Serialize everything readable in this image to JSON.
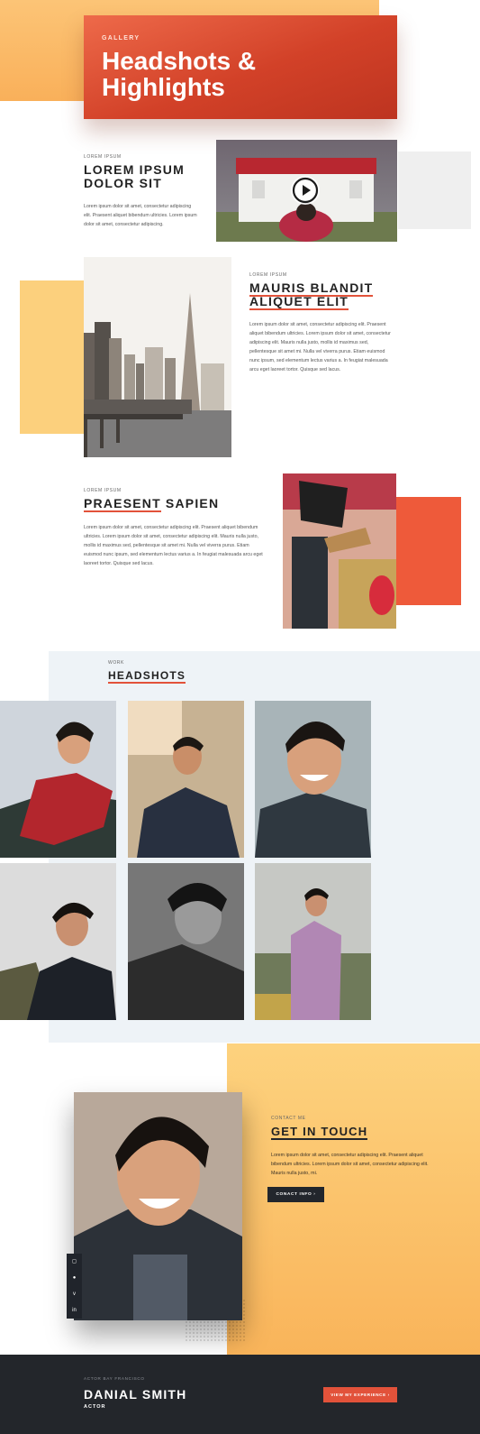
{
  "hero": {
    "kicker": "GALLERY",
    "title": "Headshots & Highlights"
  },
  "section1": {
    "kicker": "LOREM IPSUM",
    "title": "LOREM IPSUM DOLOR SIT",
    "text": "Lorem ipsum dolor sit amet, consectetur adipiscing elit. Praesent aliquet bibendum ultricies. Lorem ipsum dolor sit amet, consectetur adipiscing."
  },
  "section2": {
    "kicker": "LOREM IPSUM",
    "title": "MAURIS BLANDIT ALIQUET ELIT",
    "text": "Lorem ipsum dolor sit amet, consectetur adipiscing elit. Praesent aliquet bibendum ultricies. Lorem ipsum dolor sit amet, consectetur adipiscing elit. Mauris nulla justo, mollis id maximus sed, pellentesque sit amet mi. Nulla vel viverra purus. Etiam euismod nunc ipsum, sed elementum lectus varius a. In feugiat malesuada arcu eget laoreet tortor. Quisque sed lacus."
  },
  "section3": {
    "kicker": "LOREM IPSUM",
    "title_accent": "PRAESENT",
    "title_rest": " SAPIEN",
    "text": "Lorem ipsum dolor sit amet, consectetur adipiscing elit. Praesent aliquet bibendum ultricies. Lorem ipsum dolor sit amet, consectetur adipiscing elit. Mauris nulla justo, mollis id maximus sed, pellentesque sit amet mi. Nulla vel viverra purus. Etiam euismod nunc ipsum, sed elementum lectus varius a. In feugiat malesuada arcu eget laoreet tortor. Quisque sed lacus."
  },
  "headshots": {
    "kicker": "WORK",
    "title": "HEADSHOTS"
  },
  "contact": {
    "kicker": "CONTACT ME",
    "title": "GET IN TOUCH",
    "text": "Lorem ipsum dolor sit amet, consectetur adipiscing elit. Praesent aliquet bibendum ultricies. Lorem ipsum dolor sit amet, consectetur adipiscing elit. Mauris nulla justo, mi.",
    "button": "CONACT INFO  ›",
    "social": [
      "instagram-icon",
      "twitter-icon",
      "vimeo-icon",
      "linkedin-icon"
    ]
  },
  "footer": {
    "kicker": "ACTOR BAY FRANCISCO",
    "name": "DANIAL SMITH",
    "role": "ACTOR",
    "button": "VIEW MY EXPERIENCE  ›"
  },
  "colors": {
    "accent": "#e2523a",
    "orange": "#f9b45a",
    "dark": "#23262b",
    "gray_bg": "#eef3f7"
  }
}
